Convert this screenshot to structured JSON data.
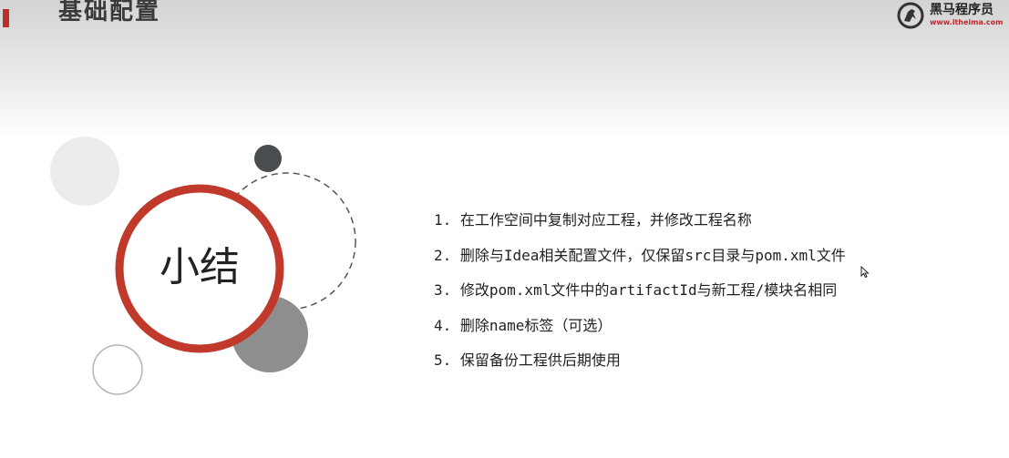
{
  "header": {
    "title": "基础配置"
  },
  "logo": {
    "name": "黑马程序员",
    "url": "www.itheima.com",
    "icon": "horse-logo-icon"
  },
  "summary": {
    "title": "小结"
  },
  "points": [
    "1. 在工作空间中复制对应工程，并修改工程名称",
    "2. 删除与Idea相关配置文件，仅保留src目录与pom.xml文件",
    "3. 修改pom.xml文件中的artifactId与新工程/模块名相同",
    "4. 删除name标签（可选）",
    "5. 保留备份工程供后期使用"
  ],
  "colors": {
    "accent": "#b8302a",
    "ring": "#c0392b",
    "dark_dot": "#4a4d4f",
    "gray_circle": "#8e8e8e",
    "light_circle": "#ececec"
  }
}
